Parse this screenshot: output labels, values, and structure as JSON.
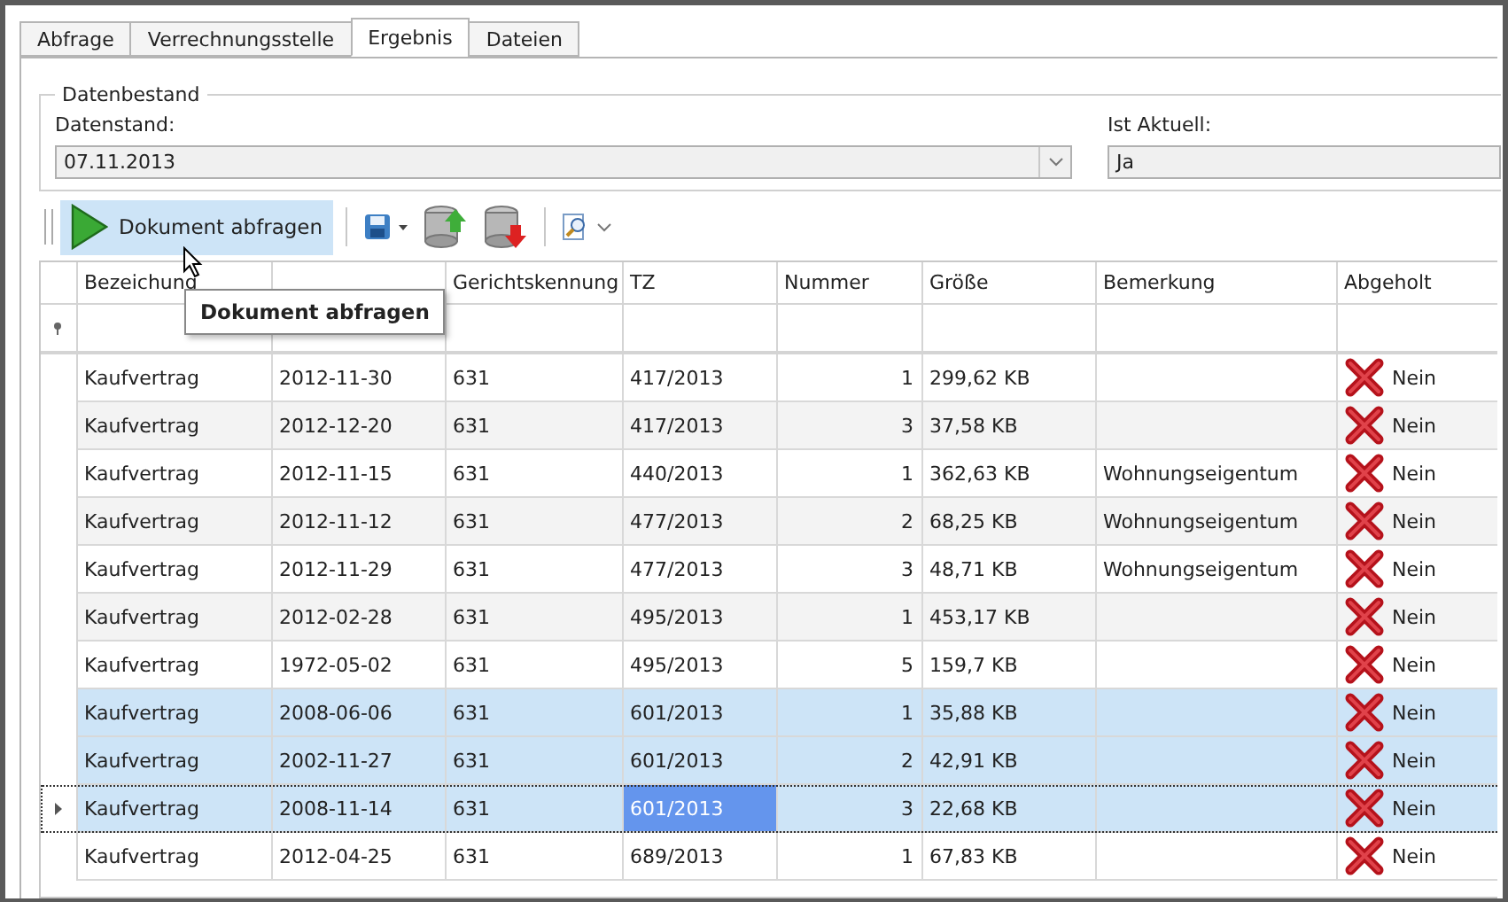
{
  "tabs": [
    {
      "label": "Abfrage",
      "selected": false
    },
    {
      "label": "Verrechnungsstelle",
      "selected": false
    },
    {
      "label": "Ergebnis",
      "selected": true
    },
    {
      "label": "Dateien",
      "selected": false
    }
  ],
  "group": {
    "title": "Datenbestand",
    "datenstand": {
      "label": "Datenstand:",
      "value": "07.11.2013"
    },
    "ist_aktuell": {
      "label": "Ist Aktuell:",
      "value": "Ja"
    }
  },
  "toolbar": {
    "query_button": "Dokument abfragen",
    "tooltip": "Dokument abfragen"
  },
  "grid": {
    "columns": [
      "Bezeichung",
      null,
      "Gerichtskennung",
      "TZ",
      "Nummer",
      "Größe",
      "Bemerkung",
      "Abgeholt"
    ],
    "rows": [
      {
        "cells": [
          "Kaufvertrag",
          "2012-11-30",
          "631",
          "417/2013",
          "1",
          "299,62 KB",
          ""
        ],
        "abgeholt": {
          "text": "Nein",
          "done": false
        },
        "selected": false,
        "focused": false
      },
      {
        "cells": [
          "Kaufvertrag",
          "2012-12-20",
          "631",
          "417/2013",
          "3",
          "37,58 KB",
          ""
        ],
        "abgeholt": {
          "text": "Nein",
          "done": false
        },
        "selected": false,
        "focused": false
      },
      {
        "cells": [
          "Kaufvertrag",
          "2012-11-15",
          "631",
          "440/2013",
          "1",
          "362,63 KB",
          "Wohnungseigentum"
        ],
        "abgeholt": {
          "text": "Nein",
          "done": false
        },
        "selected": false,
        "focused": false
      },
      {
        "cells": [
          "Kaufvertrag",
          "2012-11-12",
          "631",
          "477/2013",
          "2",
          "68,25 KB",
          "Wohnungseigentum"
        ],
        "abgeholt": {
          "text": "Nein",
          "done": false
        },
        "selected": false,
        "focused": false
      },
      {
        "cells": [
          "Kaufvertrag",
          "2012-11-29",
          "631",
          "477/2013",
          "3",
          "48,71 KB",
          "Wohnungseigentum"
        ],
        "abgeholt": {
          "text": "Nein",
          "done": false
        },
        "selected": false,
        "focused": false
      },
      {
        "cells": [
          "Kaufvertrag",
          "2012-02-28",
          "631",
          "495/2013",
          "1",
          "453,17 KB",
          ""
        ],
        "abgeholt": {
          "text": "Nein",
          "done": false
        },
        "selected": false,
        "focused": false
      },
      {
        "cells": [
          "Kaufvertrag",
          "1972-05-02",
          "631",
          "495/2013",
          "5",
          "159,7 KB",
          ""
        ],
        "abgeholt": {
          "text": "Nein",
          "done": false
        },
        "selected": false,
        "focused": false
      },
      {
        "cells": [
          "Kaufvertrag",
          "2008-06-06",
          "631",
          "601/2013",
          "1",
          "35,88 KB",
          ""
        ],
        "abgeholt": {
          "text": "Nein",
          "done": false
        },
        "selected": true,
        "focused": false
      },
      {
        "cells": [
          "Kaufvertrag",
          "2002-11-27",
          "631",
          "601/2013",
          "2",
          "42,91 KB",
          ""
        ],
        "abgeholt": {
          "text": "Nein",
          "done": false
        },
        "selected": true,
        "focused": false
      },
      {
        "cells": [
          "Kaufvertrag",
          "2008-11-14",
          "631",
          "601/2013",
          "3",
          "22,68 KB",
          ""
        ],
        "abgeholt": {
          "text": "Nein",
          "done": false
        },
        "selected": true,
        "focused": true
      },
      {
        "cells": [
          "Kaufvertrag",
          "2012-04-25",
          "631",
          "689/2013",
          "1",
          "67,83 KB",
          ""
        ],
        "abgeholt": {
          "text": "Nein",
          "done": false
        },
        "selected": false,
        "focused": false
      }
    ]
  }
}
